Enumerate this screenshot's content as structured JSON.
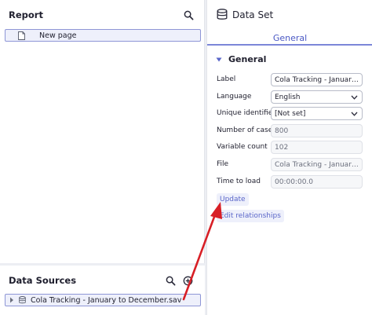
{
  "report": {
    "title": "Report",
    "page_item": "New page"
  },
  "data_sources": {
    "title": "Data Sources",
    "file_item": "Cola Tracking - January to December.sav"
  },
  "dataset": {
    "title": "Data Set",
    "tab": "General",
    "section": "General",
    "fields": {
      "label": {
        "name": "Label",
        "value": "Cola Tracking - January t..."
      },
      "language": {
        "name": "Language",
        "value": "English"
      },
      "unique_identifier": {
        "name": "Unique identifier",
        "value": "[Not set]"
      },
      "number_of_cases": {
        "name": "Number of cases",
        "value": "800"
      },
      "variable_count": {
        "name": "Variable count",
        "value": "102"
      },
      "file": {
        "name": "File",
        "value": "Cola Tracking - January t..."
      },
      "time_to_load": {
        "name": "Time to load",
        "value": "00:00:00.0"
      }
    },
    "update_label": "Update",
    "edit_relationships_label": "Edit relationships"
  },
  "colors": {
    "accent": "#4a58c4",
    "selection_bg": "#eef0fb",
    "selection_border": "#8e96d6",
    "annotation_arrow": "#d81f26"
  }
}
